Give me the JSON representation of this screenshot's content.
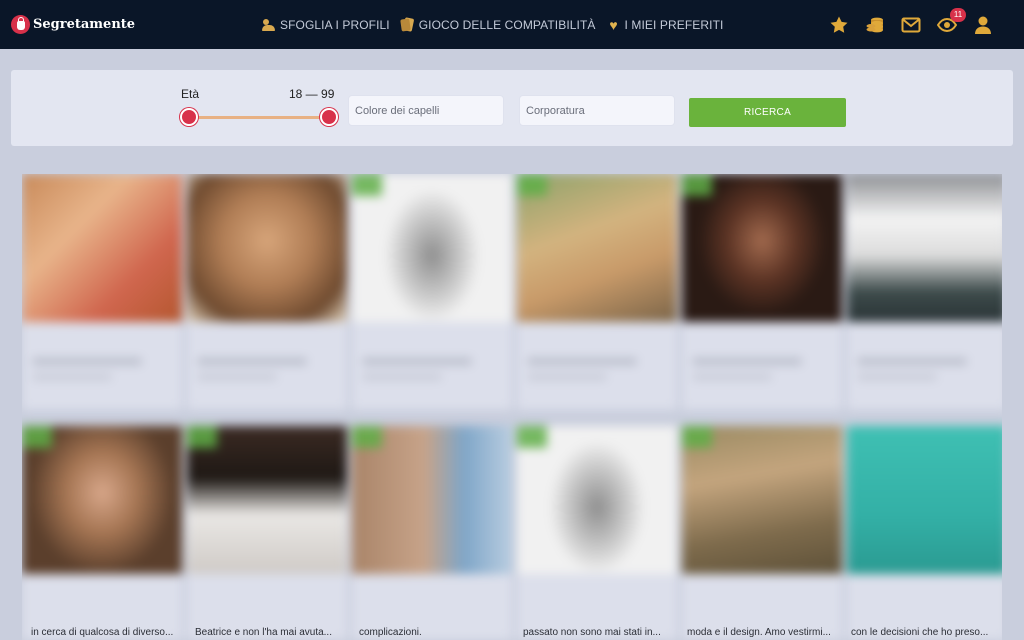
{
  "brand": {
    "name": "Segretamente"
  },
  "nav": [
    {
      "label": "SFOGLIA I PROFILI",
      "icon": "people-icon"
    },
    {
      "label": "GIOCO DELLE COMPATIBILITÀ",
      "icon": "cards-icon"
    },
    {
      "label": "I MIEI PREFERITI",
      "icon": "heart-icon"
    }
  ],
  "top_icons": [
    {
      "name": "star-icon"
    },
    {
      "name": "coins-icon"
    },
    {
      "name": "mail-icon"
    },
    {
      "name": "eye-icon",
      "badge": "11"
    },
    {
      "name": "user-icon"
    }
  ],
  "colors": {
    "topbar": "#0a1628",
    "accent": "#d8314a",
    "gold": "#e0b24e",
    "button": "#6ab33c"
  },
  "search": {
    "age_label": "Età",
    "age_range": "18 — 99",
    "age_min": 18,
    "age_max": 99,
    "hair_placeholder": "Colore dei capelli",
    "body_placeholder": "Corporatura",
    "button_label": "RICERCA"
  },
  "profiles": {
    "snippets": [
      "in cerca di qualcosa di diverso...",
      "Beatrice e non l'ha mai avuta...",
      "complicazioni.",
      "passato non sono mai stati in...",
      "moda e il design. Amo vestirmi...",
      "con le decisioni che ho preso..."
    ]
  }
}
